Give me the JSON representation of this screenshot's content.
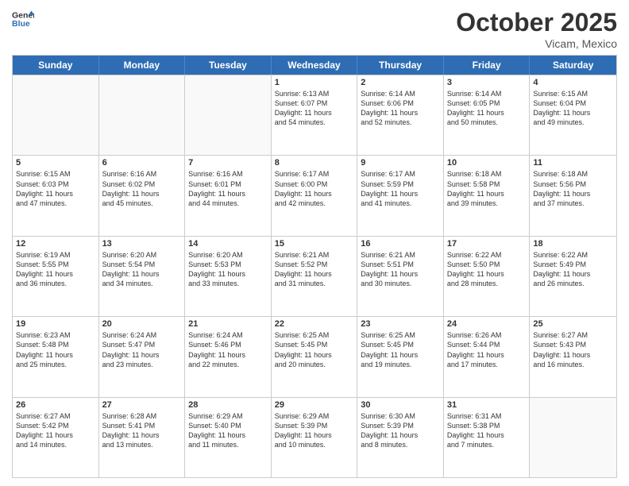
{
  "header": {
    "logo_line1": "General",
    "logo_line2": "Blue",
    "month": "October 2025",
    "location": "Vicam, Mexico"
  },
  "days_of_week": [
    "Sunday",
    "Monday",
    "Tuesday",
    "Wednesday",
    "Thursday",
    "Friday",
    "Saturday"
  ],
  "weeks": [
    [
      {
        "day": "",
        "info": "",
        "empty": true
      },
      {
        "day": "",
        "info": "",
        "empty": true
      },
      {
        "day": "",
        "info": "",
        "empty": true
      },
      {
        "day": "1",
        "info": "Sunrise: 6:13 AM\nSunset: 6:07 PM\nDaylight: 11 hours\nand 54 minutes.",
        "empty": false
      },
      {
        "day": "2",
        "info": "Sunrise: 6:14 AM\nSunset: 6:06 PM\nDaylight: 11 hours\nand 52 minutes.",
        "empty": false
      },
      {
        "day": "3",
        "info": "Sunrise: 6:14 AM\nSunset: 6:05 PM\nDaylight: 11 hours\nand 50 minutes.",
        "empty": false
      },
      {
        "day": "4",
        "info": "Sunrise: 6:15 AM\nSunset: 6:04 PM\nDaylight: 11 hours\nand 49 minutes.",
        "empty": false
      }
    ],
    [
      {
        "day": "5",
        "info": "Sunrise: 6:15 AM\nSunset: 6:03 PM\nDaylight: 11 hours\nand 47 minutes.",
        "empty": false
      },
      {
        "day": "6",
        "info": "Sunrise: 6:16 AM\nSunset: 6:02 PM\nDaylight: 11 hours\nand 45 minutes.",
        "empty": false
      },
      {
        "day": "7",
        "info": "Sunrise: 6:16 AM\nSunset: 6:01 PM\nDaylight: 11 hours\nand 44 minutes.",
        "empty": false
      },
      {
        "day": "8",
        "info": "Sunrise: 6:17 AM\nSunset: 6:00 PM\nDaylight: 11 hours\nand 42 minutes.",
        "empty": false
      },
      {
        "day": "9",
        "info": "Sunrise: 6:17 AM\nSunset: 5:59 PM\nDaylight: 11 hours\nand 41 minutes.",
        "empty": false
      },
      {
        "day": "10",
        "info": "Sunrise: 6:18 AM\nSunset: 5:58 PM\nDaylight: 11 hours\nand 39 minutes.",
        "empty": false
      },
      {
        "day": "11",
        "info": "Sunrise: 6:18 AM\nSunset: 5:56 PM\nDaylight: 11 hours\nand 37 minutes.",
        "empty": false
      }
    ],
    [
      {
        "day": "12",
        "info": "Sunrise: 6:19 AM\nSunset: 5:55 PM\nDaylight: 11 hours\nand 36 minutes.",
        "empty": false
      },
      {
        "day": "13",
        "info": "Sunrise: 6:20 AM\nSunset: 5:54 PM\nDaylight: 11 hours\nand 34 minutes.",
        "empty": false
      },
      {
        "day": "14",
        "info": "Sunrise: 6:20 AM\nSunset: 5:53 PM\nDaylight: 11 hours\nand 33 minutes.",
        "empty": false
      },
      {
        "day": "15",
        "info": "Sunrise: 6:21 AM\nSunset: 5:52 PM\nDaylight: 11 hours\nand 31 minutes.",
        "empty": false
      },
      {
        "day": "16",
        "info": "Sunrise: 6:21 AM\nSunset: 5:51 PM\nDaylight: 11 hours\nand 30 minutes.",
        "empty": false
      },
      {
        "day": "17",
        "info": "Sunrise: 6:22 AM\nSunset: 5:50 PM\nDaylight: 11 hours\nand 28 minutes.",
        "empty": false
      },
      {
        "day": "18",
        "info": "Sunrise: 6:22 AM\nSunset: 5:49 PM\nDaylight: 11 hours\nand 26 minutes.",
        "empty": false
      }
    ],
    [
      {
        "day": "19",
        "info": "Sunrise: 6:23 AM\nSunset: 5:48 PM\nDaylight: 11 hours\nand 25 minutes.",
        "empty": false
      },
      {
        "day": "20",
        "info": "Sunrise: 6:24 AM\nSunset: 5:47 PM\nDaylight: 11 hours\nand 23 minutes.",
        "empty": false
      },
      {
        "day": "21",
        "info": "Sunrise: 6:24 AM\nSunset: 5:46 PM\nDaylight: 11 hours\nand 22 minutes.",
        "empty": false
      },
      {
        "day": "22",
        "info": "Sunrise: 6:25 AM\nSunset: 5:45 PM\nDaylight: 11 hours\nand 20 minutes.",
        "empty": false
      },
      {
        "day": "23",
        "info": "Sunrise: 6:25 AM\nSunset: 5:45 PM\nDaylight: 11 hours\nand 19 minutes.",
        "empty": false
      },
      {
        "day": "24",
        "info": "Sunrise: 6:26 AM\nSunset: 5:44 PM\nDaylight: 11 hours\nand 17 minutes.",
        "empty": false
      },
      {
        "day": "25",
        "info": "Sunrise: 6:27 AM\nSunset: 5:43 PM\nDaylight: 11 hours\nand 16 minutes.",
        "empty": false
      }
    ],
    [
      {
        "day": "26",
        "info": "Sunrise: 6:27 AM\nSunset: 5:42 PM\nDaylight: 11 hours\nand 14 minutes.",
        "empty": false
      },
      {
        "day": "27",
        "info": "Sunrise: 6:28 AM\nSunset: 5:41 PM\nDaylight: 11 hours\nand 13 minutes.",
        "empty": false
      },
      {
        "day": "28",
        "info": "Sunrise: 6:29 AM\nSunset: 5:40 PM\nDaylight: 11 hours\nand 11 minutes.",
        "empty": false
      },
      {
        "day": "29",
        "info": "Sunrise: 6:29 AM\nSunset: 5:39 PM\nDaylight: 11 hours\nand 10 minutes.",
        "empty": false
      },
      {
        "day": "30",
        "info": "Sunrise: 6:30 AM\nSunset: 5:39 PM\nDaylight: 11 hours\nand 8 minutes.",
        "empty": false
      },
      {
        "day": "31",
        "info": "Sunrise: 6:31 AM\nSunset: 5:38 PM\nDaylight: 11 hours\nand 7 minutes.",
        "empty": false
      },
      {
        "day": "",
        "info": "",
        "empty": true
      }
    ]
  ]
}
